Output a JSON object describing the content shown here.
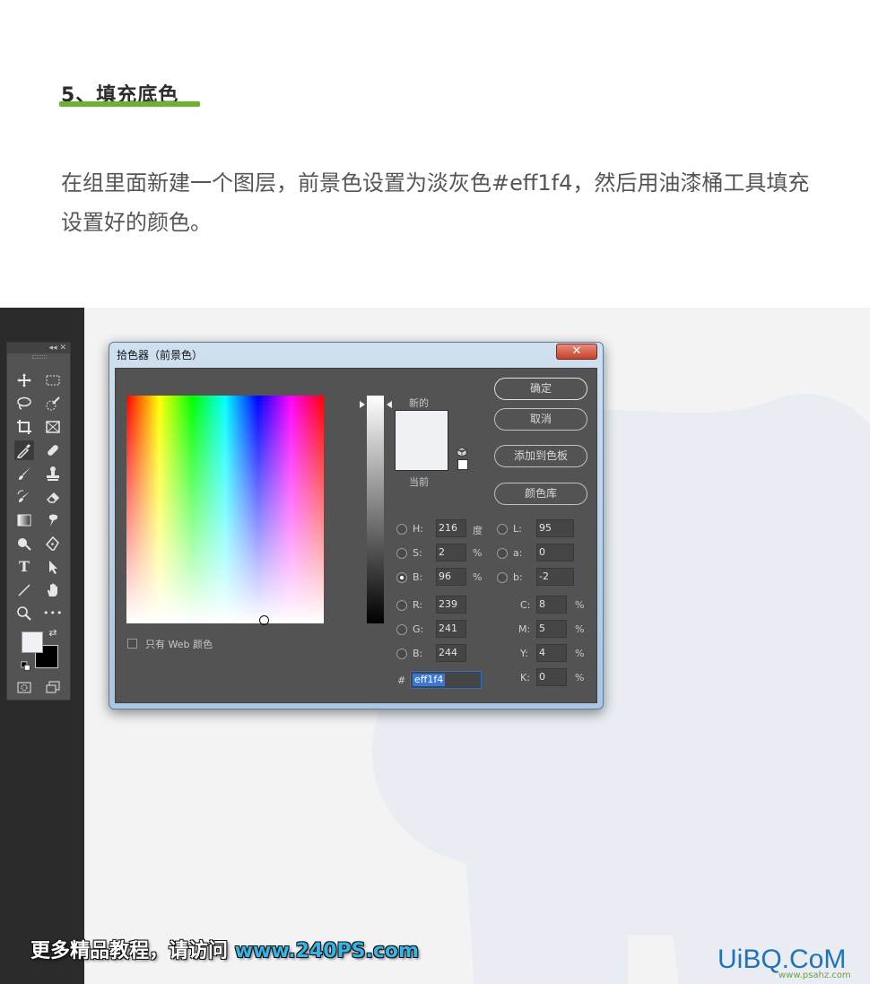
{
  "article": {
    "heading": "5、填充底色",
    "paragraph": "在组里面新建一个图层，前景色设置为淡灰色#eff1f4，然后用油漆桶工具填充设置好的颜色。",
    "accent_color": "#6bb232"
  },
  "toolbar": {
    "collapse_label": "◂◂",
    "close_label": "✕",
    "tools": [
      "move-tool",
      "marquee-tool",
      "lasso-tool",
      "quick-select-tool",
      "crop-tool",
      "frame-tool",
      "eyedropper-tool",
      "healing-brush-tool",
      "brush-tool",
      "clone-stamp-tool",
      "history-brush-tool",
      "eraser-tool",
      "gradient-tool",
      "smudge-tool",
      "dodge-tool",
      "pen-tool",
      "type-tool",
      "path-select-tool",
      "line-tool",
      "hand-tool",
      "zoom-tool",
      "more-tools"
    ],
    "type_tool_glyph": "T",
    "more_tools_glyph": "•••",
    "foreground_color": "#eff1f4",
    "background_color": "#000000"
  },
  "picker": {
    "title": "拾色器（前景色）",
    "close_glyph": "✕",
    "new_label": "新的",
    "current_label": "当前",
    "buttons": {
      "ok": "确定",
      "cancel": "取消",
      "add_to_swatches": "添加到色板",
      "color_libraries": "颜色库"
    },
    "web_only_label": "只有 Web 颜色",
    "hsb": {
      "h": {
        "label": "H:",
        "value": "216",
        "unit": "度"
      },
      "s": {
        "label": "S:",
        "value": "2",
        "unit": "%"
      },
      "b": {
        "label": "B:",
        "value": "96",
        "unit": "%"
      }
    },
    "rgb": {
      "r": {
        "label": "R:",
        "value": "239"
      },
      "g": {
        "label": "G:",
        "value": "241"
      },
      "b": {
        "label": "B:",
        "value": "244"
      }
    },
    "lab": {
      "l": {
        "label": "L:",
        "value": "95"
      },
      "a": {
        "label": "a:",
        "value": "0"
      },
      "b": {
        "label": "b:",
        "value": "-2"
      }
    },
    "cmyk": {
      "c": {
        "label": "C:",
        "value": "8",
        "unit": "%"
      },
      "m": {
        "label": "M:",
        "value": "5",
        "unit": "%"
      },
      "y": {
        "label": "Y:",
        "value": "4",
        "unit": "%"
      },
      "k": {
        "label": "K:",
        "value": "0",
        "unit": "%"
      }
    },
    "hex_prefix": "#",
    "hex_value": "eff1f4",
    "new_color": "#eff1f4",
    "current_color": "#eff1f4"
  },
  "watermarks": {
    "left_text": "更多精品教程，请访问 ",
    "left_url": "www.240PS.com",
    "right_logo": "UiBQ.CoM",
    "right_small": "www.psahz.com"
  }
}
